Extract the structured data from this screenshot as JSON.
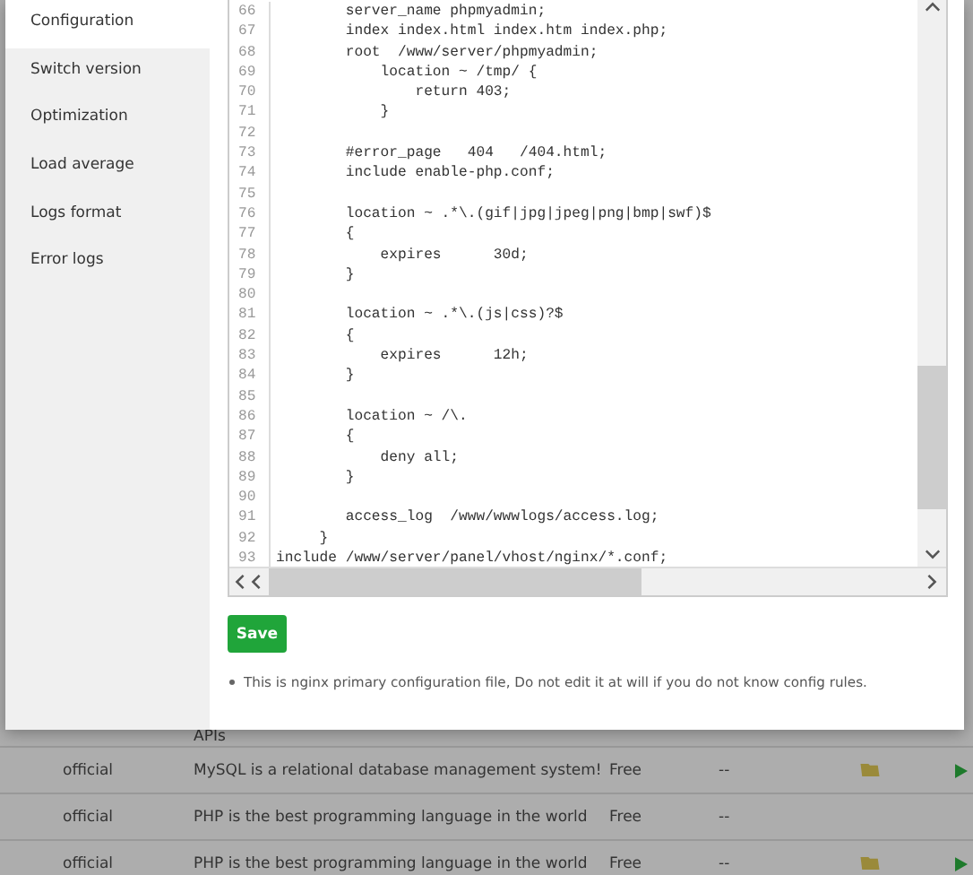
{
  "sidebar": {
    "items": [
      {
        "label": "Configuration",
        "selected": true
      },
      {
        "label": "Switch version",
        "selected": false
      },
      {
        "label": "Optimization",
        "selected": false
      },
      {
        "label": "Load average",
        "selected": false
      },
      {
        "label": "Logs format",
        "selected": false
      },
      {
        "label": "Error logs",
        "selected": false
      }
    ]
  },
  "editor": {
    "lines": [
      {
        "number": "66",
        "text": "        server_name phpmyadmin;"
      },
      {
        "number": "67",
        "text": "        index index.html index.htm index.php;"
      },
      {
        "number": "68",
        "text": "        root  /www/server/phpmyadmin;"
      },
      {
        "number": "69",
        "text": "            location ~ /tmp/ {"
      },
      {
        "number": "70",
        "text": "                return 403;"
      },
      {
        "number": "71",
        "text": "            }"
      },
      {
        "number": "72"
      },
      {
        "number": "73",
        "text": "        #error_page   404   /404.html;"
      },
      {
        "number": "74",
        "text": "        include enable-php.conf;"
      },
      {
        "number": "75"
      },
      {
        "number": "76",
        "text": "        location ~ .*\\.(gif|jpg|jpeg|png|bmp|swf)$"
      },
      {
        "number": "77",
        "text": "        {"
      },
      {
        "number": "78",
        "text": "            expires      30d;"
      },
      {
        "number": "79",
        "text": "        }"
      },
      {
        "number": "80"
      },
      {
        "number": "81",
        "text": "        location ~ .*\\.(js|css)?$"
      },
      {
        "number": "82",
        "text": "        {"
      },
      {
        "number": "83",
        "text": "            expires      12h;"
      },
      {
        "number": "84",
        "text": "        }"
      },
      {
        "number": "85"
      },
      {
        "number": "86",
        "text": "        location ~ /\\."
      },
      {
        "number": "87",
        "text": "        {"
      },
      {
        "number": "88",
        "text": "            deny all;"
      },
      {
        "number": "89",
        "text": "        }"
      },
      {
        "number": "90"
      },
      {
        "number": "91",
        "text": "        access_log  /www/wwwlogs/access.log;"
      },
      {
        "number": "92",
        "text": "     }"
      },
      {
        "number": "93",
        "text": "include /www/server/panel/vhost/nginx/*.conf;"
      }
    ]
  },
  "save_button": "Save",
  "note": "This is nginx primary configuration file, Do not edit it at will if you do not know config rules.",
  "table": {
    "overflow_text": "APIs",
    "rows": [
      {
        "type": "official",
        "description": "MySQL is a relational database management system!",
        "price": "Free",
        "expire": "--",
        "icons": true
      },
      {
        "type": "official",
        "description": "PHP is the best programming language in the world",
        "price": "Free",
        "expire": "--",
        "icons": false
      },
      {
        "type": "official",
        "description": "PHP is the best programming language in the world",
        "price": "Free",
        "expire": "--",
        "icons": true
      }
    ]
  }
}
